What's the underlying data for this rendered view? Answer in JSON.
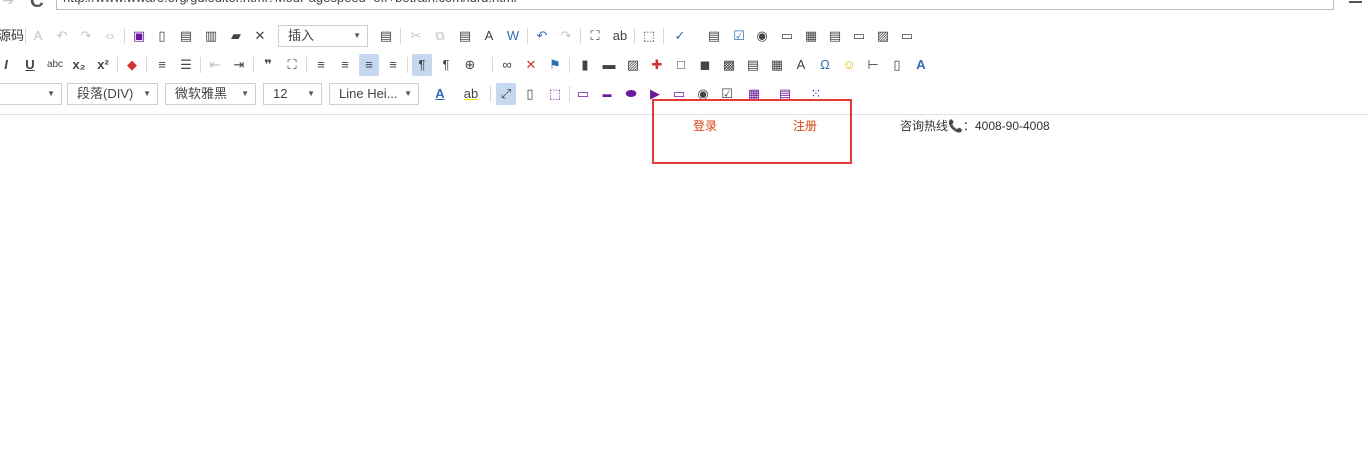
{
  "browser": {
    "url": "http://www.wware.org/gdleditor.html?ModPagespeed=off+betrain.com/lurd.html"
  },
  "toolbar": {
    "source_label": "源码",
    "insert_select": "插入",
    "block_format": "段落(DIV)",
    "font_family": "微软雅黑",
    "font_size": "12",
    "line_height": "Line Hei...",
    "icons_row1": [
      "select-all-icon",
      "undo-gray-icon",
      "redo-gray-icon",
      "code-icon",
      "save-icon",
      "new-doc-icon",
      "preview-icon",
      "print-icon",
      "lock-icon",
      "close-icon",
      "template-icon",
      "cut-icon",
      "copy-icon",
      "paste-icon",
      "paste-text-icon",
      "paste-word-icon",
      "undo-icon",
      "redo-icon",
      "find-icon",
      "replace-icon",
      "select-icon",
      "spellcheck-icon",
      "form-icon",
      "checkbox-icon",
      "radio-icon",
      "textfield-icon",
      "textarea-icon",
      "select-field-icon",
      "hidden-field-icon",
      "image-button-icon",
      "button-icon"
    ],
    "icons_row2": [
      "italic-icon",
      "underline-icon",
      "strikethrough-icon",
      "subscript-icon",
      "superscript-icon",
      "remove-format-icon",
      "ordered-list-icon",
      "unordered-list-icon",
      "outdent-icon",
      "indent-icon",
      "blockquote-icon",
      "find-replace-icon",
      "align-left-icon",
      "align-center-icon",
      "align-right-icon",
      "justify-icon",
      "ltr-icon",
      "rtl-icon",
      "language-icon",
      "link-icon",
      "unlink-icon",
      "anchor-icon",
      "chart-icon",
      "flash-icon",
      "image-icon",
      "plugin-icon",
      "iframe-icon",
      "page-break-icon",
      "div-icon",
      "table-icon",
      "text-tool-icon",
      "special-char-icon",
      "smiley-icon",
      "horizontal-line-icon",
      "page-icon",
      "text-effect-icon"
    ],
    "icons_row3": [
      "font-color-icon",
      "highlight-color-icon",
      "maximize-icon",
      "show-blocks-icon",
      "show-borders-icon",
      "placeholder-icon",
      "ok-button-icon",
      "media-icon",
      "play-icon",
      "gallery-icon",
      "visibility-icon",
      "checkbox-form-icon",
      "grid-icon",
      "table-tools-icon",
      "layout-icon"
    ]
  },
  "content": {
    "login": "登录",
    "register": "注册",
    "hotline_label": "咨询热线",
    "phone_icon": "📞",
    "hotline_value": "：4008-90-4008"
  },
  "colors": {
    "link_red": "#d84315",
    "highlight_box": "#e53935",
    "toolbar_active": "#c6d8f0"
  }
}
